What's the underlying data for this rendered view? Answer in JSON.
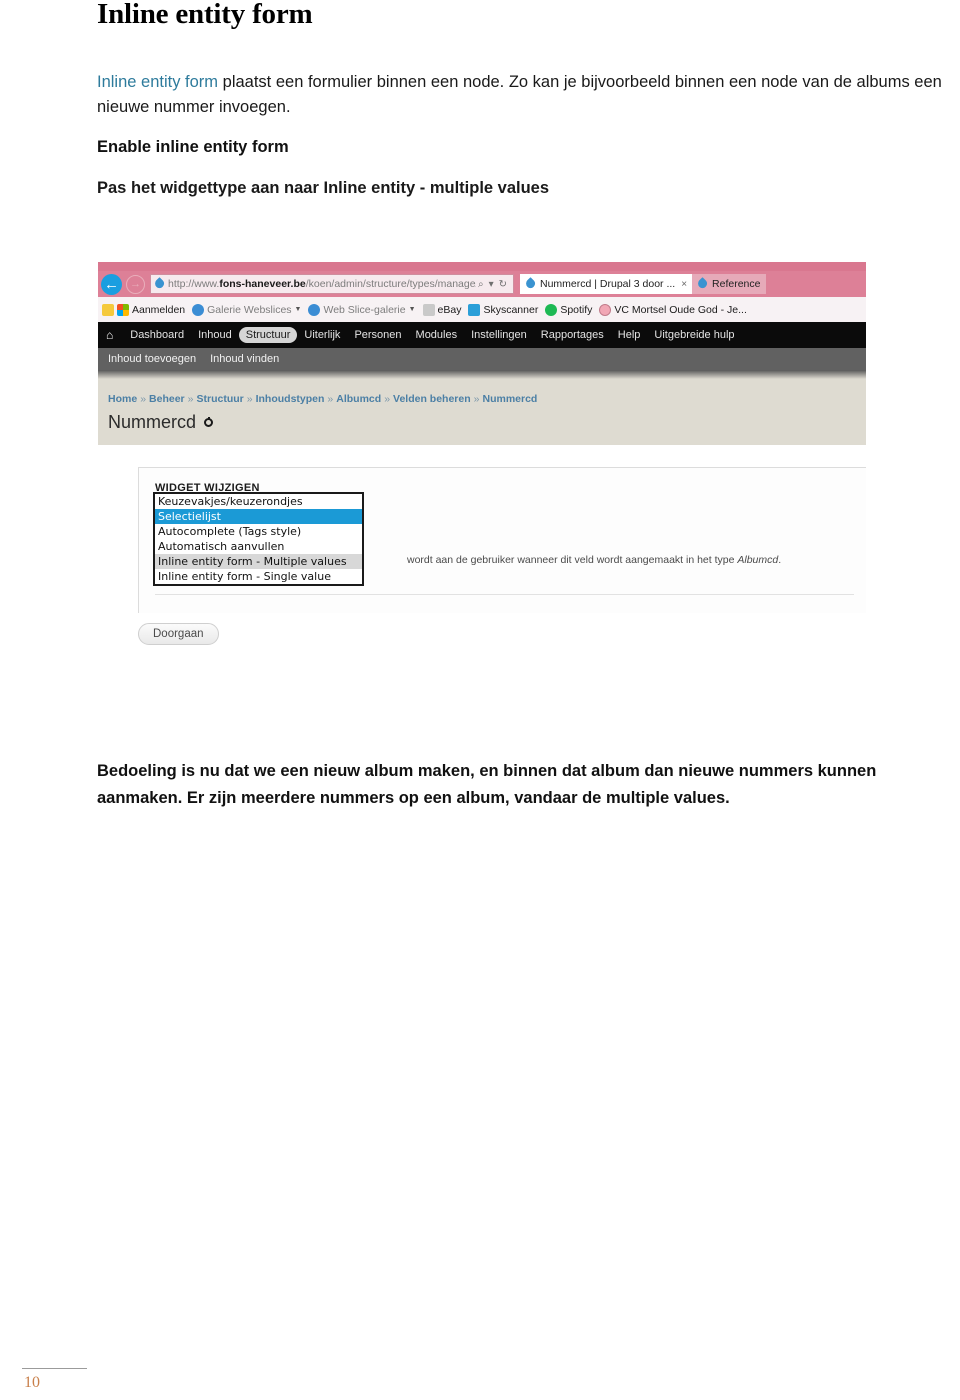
{
  "document": {
    "title": "Inline entity form",
    "intro": {
      "link_text": "Inline entity form",
      "rest": " plaatst een formulier binnen een node. Zo kan je bijvoorbeeld binnen een node van de albums een nieuwe nummer invoegen."
    },
    "subheading": "Enable inline entity form",
    "instruction": "Pas het widgettype aan naar Inline entity - multiple values",
    "closing": "Bedoeling is nu dat we een nieuw album maken, en binnen dat album dan nieuwe nummers kunnen aanmaken. Er zijn meerdere nummers op een album, vandaar de multiple values.",
    "page_number": "10"
  },
  "screenshot": {
    "browser": {
      "back_icon": "←",
      "forward_icon": "→",
      "url_prefix": "http://www.",
      "url_domain": "fons-haneveer.be",
      "url_path": "/koen/admin/structure/types/manage/album/",
      "url_search_icon": "⌕",
      "url_dropdown_icon": "▾",
      "url_refresh_icon": "↻",
      "tabs": [
        {
          "label": "Nummercd | Drupal 3 door ...",
          "close": "×",
          "active": true
        },
        {
          "label": "Reference",
          "close": "",
          "active": false
        }
      ],
      "favorites": [
        {
          "label": "Aanmelden",
          "icon": "microsoft-icon",
          "caret": false,
          "dim": false
        },
        {
          "label": "Galerie Webslices",
          "icon": "ie-icon",
          "caret": true,
          "dim": true
        },
        {
          "label": "Web Slice-galerie",
          "icon": "ie-icon",
          "caret": true,
          "dim": true
        },
        {
          "label": "eBay",
          "icon": "ebay-icon",
          "caret": false,
          "dim": false
        },
        {
          "label": "Skyscanner",
          "icon": "skyscanner-icon",
          "caret": false,
          "dim": false
        },
        {
          "label": "Spotify",
          "icon": "spotify-icon",
          "caret": false,
          "dim": false
        },
        {
          "label": "VC Mortsel Oude God - Je...",
          "icon": "vc-icon",
          "caret": false,
          "dim": false
        }
      ]
    },
    "drupal": {
      "home_icon": "⌂",
      "toolbar": [
        {
          "label": "Dashboard",
          "active": false
        },
        {
          "label": "Inhoud",
          "active": false
        },
        {
          "label": "Structuur",
          "active": true
        },
        {
          "label": "Uiterlijk",
          "active": false
        },
        {
          "label": "Personen",
          "active": false
        },
        {
          "label": "Modules",
          "active": false
        },
        {
          "label": "Instellingen",
          "active": false
        },
        {
          "label": "Rapportages",
          "active": false
        },
        {
          "label": "Help",
          "active": false
        },
        {
          "label": "Uitgebreide hulp",
          "active": false
        }
      ],
      "subbar": [
        {
          "label": "Inhoud toevoegen"
        },
        {
          "label": "Inhoud vinden"
        }
      ],
      "breadcrumb": [
        "Home",
        "Beheer",
        "Structuur",
        "Inhoudstypen",
        "Albumcd",
        "Velden beheren",
        "Nummercd"
      ],
      "breadcrumb_separator": "»",
      "page_heading": "Nummercd",
      "panel": {
        "title": "WIDGET WIJZIGEN",
        "help_before": "wordt aan de gebruiker wanneer dit veld wordt aangemaakt in het type ",
        "help_italic": "Albumcd",
        "help_after": ".",
        "options": [
          {
            "label": "Keuzevakjes/keuzerondjes",
            "state": "normal"
          },
          {
            "label": "Selectielijst",
            "state": "selected"
          },
          {
            "label": "Autocomplete (Tags style)",
            "state": "normal"
          },
          {
            "label": "Automatisch aanvullen",
            "state": "normal"
          },
          {
            "label": "Inline entity form - Multiple values",
            "state": "hover"
          },
          {
            "label": "Inline entity form - Single value",
            "state": "normal"
          }
        ],
        "submit_label": "Doorgaan"
      }
    }
  },
  "colors": {
    "link": "#2e7b9c",
    "browser_chrome": "#dd8097",
    "select_highlight": "#1b9ad6",
    "drupal_header": "#dedbd1",
    "page_number": "#c87f4a"
  }
}
